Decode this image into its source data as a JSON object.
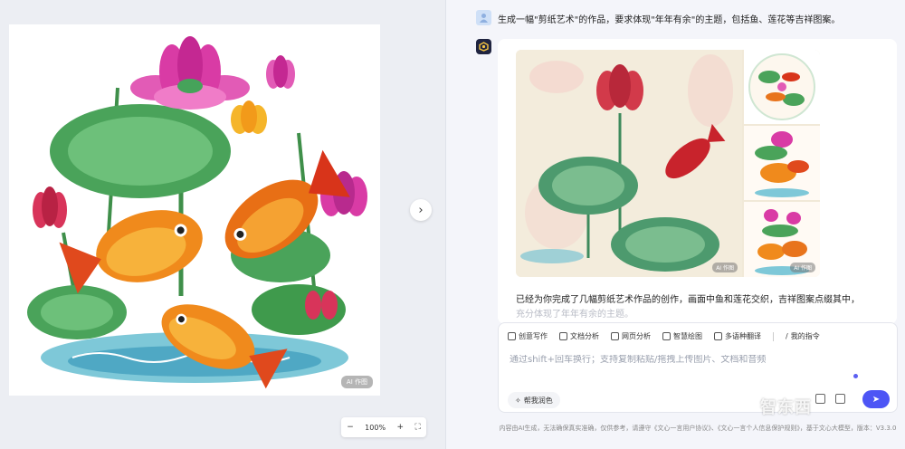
{
  "viewer": {
    "badge": "AI 作图",
    "next_icon": "chevron-right-icon",
    "zoom": {
      "minus": "−",
      "value": "100%",
      "plus": "+",
      "fullscreen_icon": "fullscreen-icon"
    }
  },
  "chat": {
    "user_message": "生成一幅\"剪纸艺术\"的作品，要求体现\"年年有余\"的主题，包括鱼、莲花等吉祥图案。",
    "thumb_badge": "AI 作图",
    "response_line": "已经为你完成了几幅剪纸艺术作品的创作，画面中鱼和莲花交织，吉祥图案点缀其中，",
    "response_faded": "充分体现了年年有余的主题。"
  },
  "toolbar": {
    "items": [
      {
        "label": "创意写作",
        "icon": "pen-icon"
      },
      {
        "label": "文档分析",
        "icon": "document-icon"
      },
      {
        "label": "网页分析",
        "icon": "webpage-icon"
      },
      {
        "label": "智慧绘图",
        "icon": "image-icon"
      },
      {
        "label": "多语种翻译",
        "icon": "translate-icon"
      }
    ],
    "my_commands": "我的指令"
  },
  "input": {
    "placeholder": "通过shift+回车换行；支持复制粘贴/拖拽上传图片、文档和音频",
    "polish_label": "帮我润色"
  },
  "footer": {
    "disclaimer": "内容由AI生成，无法确保真实准确，仅供参考，请遵守《文心一言用户协议》、《文心一言个人信息保护规则》，基于文心大模型，版本：V3.3.0"
  },
  "watermark": "智东西",
  "colors": {
    "accent": "#4d55f5",
    "lotus_pink": "#d93ba5",
    "fish_orange": "#f08a1c",
    "leaf_green": "#3f9a4c"
  }
}
